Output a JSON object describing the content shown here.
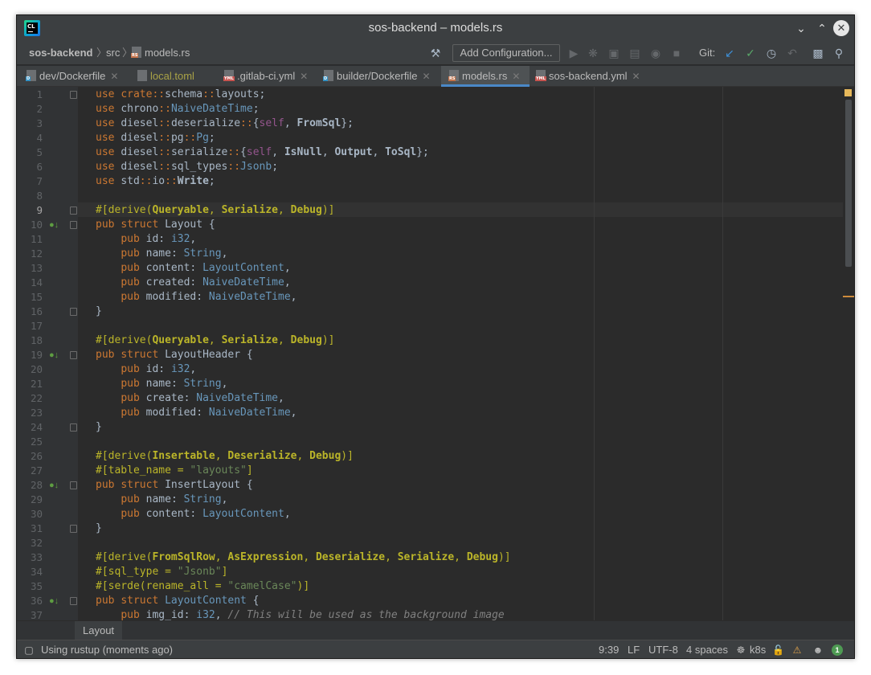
{
  "window": {
    "title": "sos-backend – models.rs",
    "app_logo_text": "CL"
  },
  "navbar": {
    "project": "sos-backend",
    "folder": "src",
    "file": "models.rs",
    "add_configuration": "Add Configuration...",
    "git_label": "Git:"
  },
  "tabs": [
    {
      "label": "dev/Dockerfile",
      "icon": "docker-file-icon",
      "active": false
    },
    {
      "label": "local.toml",
      "icon": "toml-file-icon",
      "active": false
    },
    {
      "label": ".gitlab-ci.yml",
      "icon": "yml-file-icon",
      "active": false
    },
    {
      "label": "builder/Dockerfile",
      "icon": "docker-file-icon",
      "active": false
    },
    {
      "label": "models.rs",
      "icon": "rust-file-icon",
      "active": true
    },
    {
      "label": "sos-backend.yml",
      "icon": "yml-file-icon",
      "active": false
    }
  ],
  "editor": {
    "current_line": 9,
    "lines": [
      "use crate::schema::layouts;",
      "use chrono::NaiveDateTime;",
      "use diesel::deserialize::{self, FromSql};",
      "use diesel::pg::Pg;",
      "use diesel::serialize::{self, IsNull, Output, ToSql};",
      "use diesel::sql_types::Jsonb;",
      "use std::io::Write;",
      "",
      "#[derive(Queryable, Serialize, Debug)]",
      "pub struct Layout {",
      "    pub id: i32,",
      "    pub name: String,",
      "    pub content: LayoutContent,",
      "    pub created: NaiveDateTime,",
      "    pub modified: NaiveDateTime,",
      "}",
      "",
      "#[derive(Queryable, Serialize, Debug)]",
      "pub struct LayoutHeader {",
      "    pub id: i32,",
      "    pub name: String,",
      "    pub create: NaiveDateTime,",
      "    pub modified: NaiveDateTime,",
      "}",
      "",
      "#[derive(Insertable, Deserialize, Debug)]",
      "#[table_name = \"layouts\"]",
      "pub struct InsertLayout {",
      "    pub name: String,",
      "    pub content: LayoutContent,",
      "}",
      "",
      "#[derive(FromSqlRow, AsExpression, Deserialize, Serialize, Debug)]",
      "#[sql_type = \"Jsonb\"]",
      "#[serde(rename_all = \"camelCase\")]",
      "pub struct LayoutContent {",
      "    pub img_id: i32, // This will be used as the background image"
    ]
  },
  "breadcrumb_bar": {
    "item": "Layout"
  },
  "status": {
    "message": "Using rustup (moments ago)",
    "position": "9:39",
    "line_separator": "LF",
    "encoding": "UTF-8",
    "indent": "4 spaces",
    "k8s": "k8s",
    "notifications": "1"
  }
}
